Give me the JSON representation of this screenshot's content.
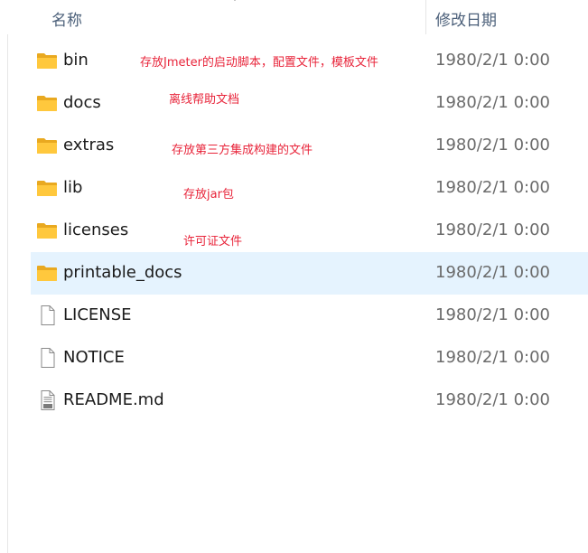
{
  "header": {
    "name_label": "名称",
    "date_label": "修改日期"
  },
  "files": [
    {
      "name": "bin",
      "date": "1980/2/1 0:00",
      "kind": "folder-icon",
      "selected": false
    },
    {
      "name": "docs",
      "date": "1980/2/1 0:00",
      "kind": "folder-icon",
      "selected": false
    },
    {
      "name": "extras",
      "date": "1980/2/1 0:00",
      "kind": "folder-icon",
      "selected": false
    },
    {
      "name": "lib",
      "date": "1980/2/1 0:00",
      "kind": "folder-icon",
      "selected": false
    },
    {
      "name": "licenses",
      "date": "1980/2/1 0:00",
      "kind": "folder-icon",
      "selected": false
    },
    {
      "name": "printable_docs",
      "date": "1980/2/1 0:00",
      "kind": "folder-icon",
      "selected": true
    },
    {
      "name": "LICENSE",
      "date": "1980/2/1 0:00",
      "kind": "file-icon",
      "selected": false
    },
    {
      "name": "NOTICE",
      "date": "1980/2/1 0:00",
      "kind": "file-icon",
      "selected": false
    },
    {
      "name": "README.md",
      "date": "1980/2/1 0:00",
      "kind": "markdown-file-icon",
      "selected": false
    }
  ],
  "annotations": {
    "bin": "存放Jmeter的启动脚本，配置文件，模板文件",
    "docs": "离线帮助文档",
    "extras": "存放第三方集成构建的文件",
    "lib": "存放jar包",
    "licenses": "许可证文件"
  },
  "colors": {
    "annotation": "#e8243a",
    "selected_row": "#e5f3fe",
    "folder": "#ffc83d"
  }
}
